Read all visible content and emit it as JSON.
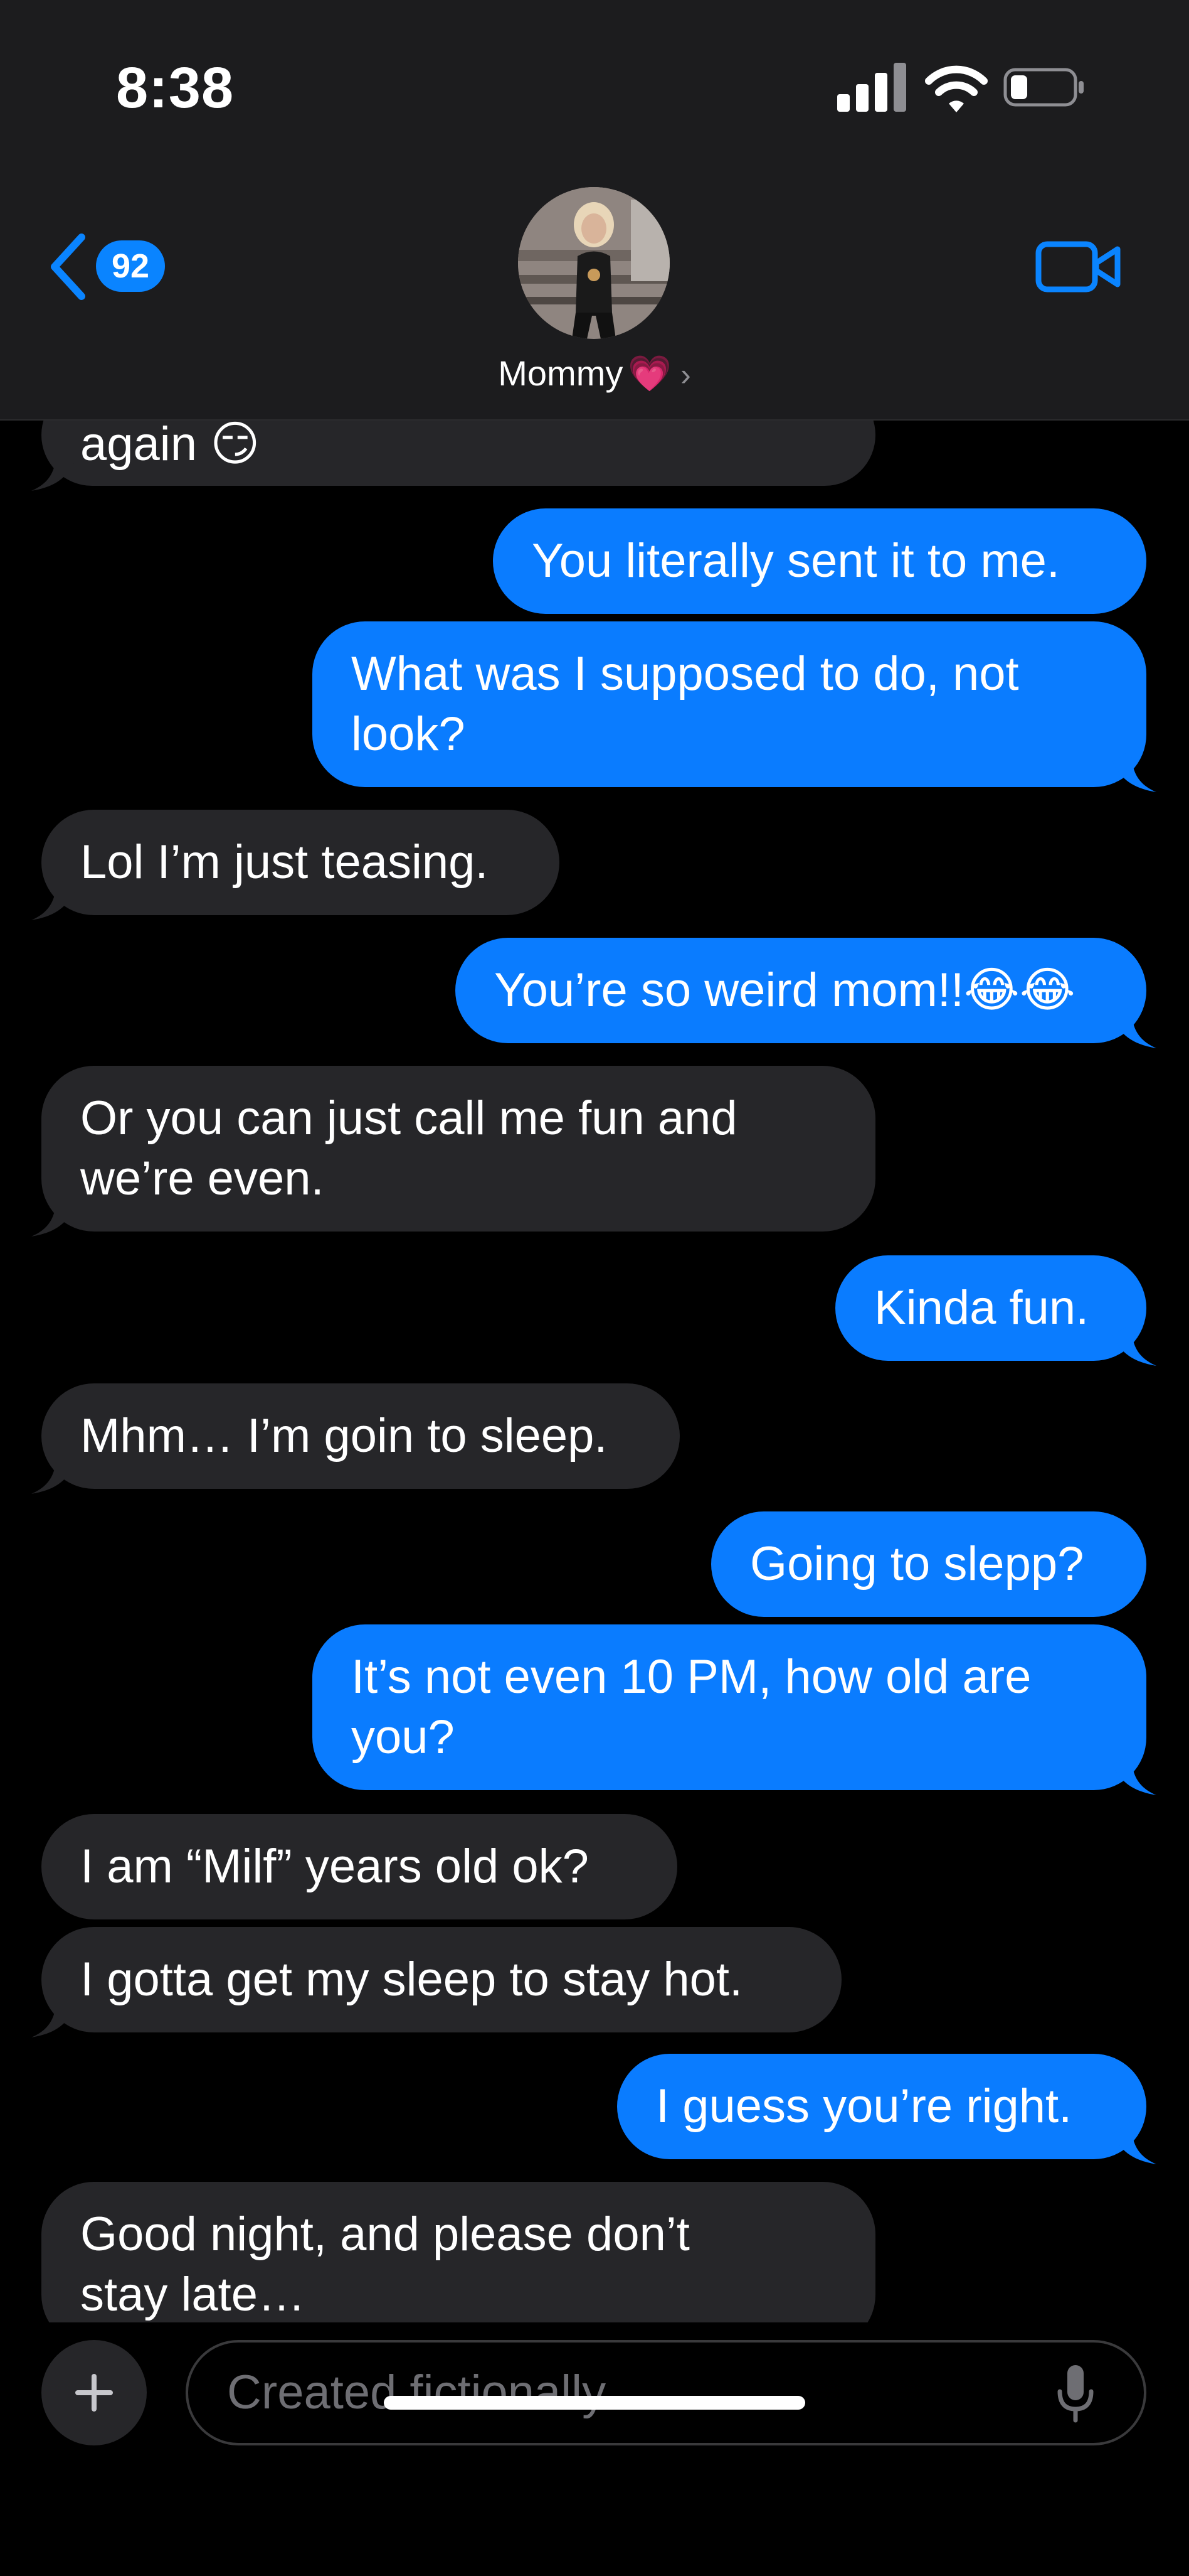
{
  "status_bar": {
    "time": "8:38"
  },
  "header": {
    "back_badge": "92",
    "contact_name": "Mommy",
    "heart": "💗",
    "chevron": "›"
  },
  "messages": [
    {
      "from": "them",
      "lines": [
        "again 😏"
      ]
    },
    {
      "from": "me",
      "lines": [
        "You literally sent it to me."
      ]
    },
    {
      "from": "me",
      "lines": [
        "What was I supposed to do, not",
        "look?"
      ]
    },
    {
      "from": "them",
      "lines": [
        "Lol I’m just teasing."
      ]
    },
    {
      "from": "me",
      "lines": [
        "You’re so weird mom!!😂😂"
      ]
    },
    {
      "from": "them",
      "lines": [
        "Or you can just call me fun and",
        "we’re even."
      ]
    },
    {
      "from": "me",
      "lines": [
        "Kinda fun."
      ]
    },
    {
      "from": "them",
      "lines": [
        "Mhm… I’m goin to sleep."
      ]
    },
    {
      "from": "me",
      "lines": [
        "Going to slepp?"
      ]
    },
    {
      "from": "me",
      "lines": [
        "It’s not even 10 PM, how old are",
        "you?"
      ]
    },
    {
      "from": "them",
      "lines": [
        "I am “Milf” years old ok?"
      ]
    },
    {
      "from": "them",
      "lines": [
        "I gotta get my sleep to stay hot."
      ]
    },
    {
      "from": "me",
      "lines": [
        "I guess you’re right."
      ]
    },
    {
      "from": "them",
      "lines": [
        "Good night, and please don’t",
        "stay late…"
      ]
    }
  ],
  "composer": {
    "placeholder": "Created fictionally"
  },
  "colors": {
    "outgoing": "#0a7cff",
    "incoming": "#262629",
    "accent": "#0a84ff"
  },
  "icons": [
    "signal-icon",
    "wifi-icon",
    "battery-icon",
    "back-chevron-icon",
    "video-camera-icon",
    "plus-icon",
    "microphone-icon"
  ]
}
